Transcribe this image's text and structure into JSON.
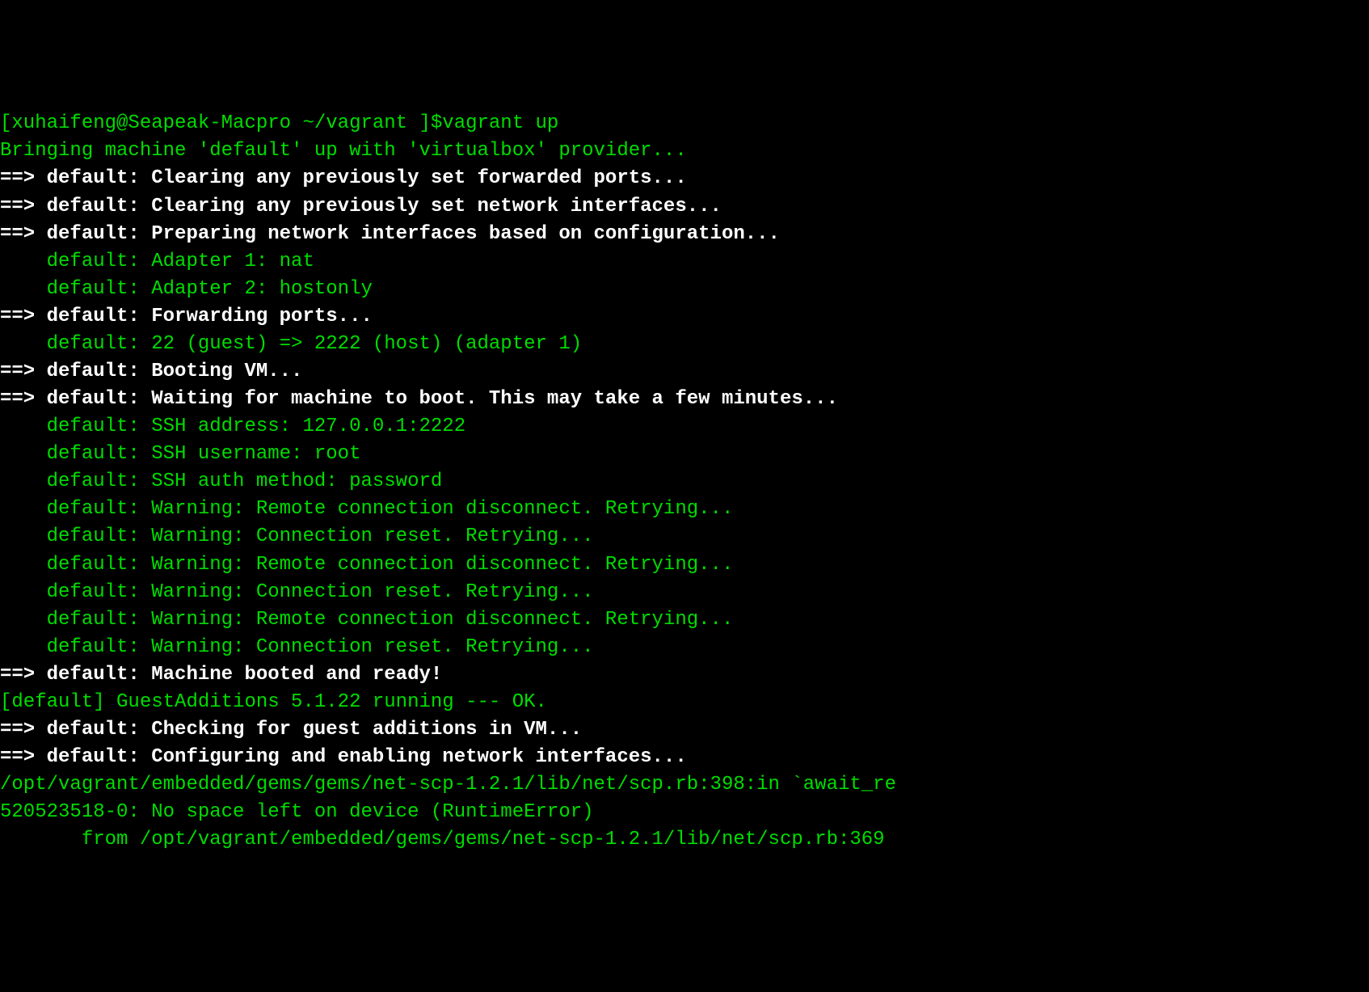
{
  "lines": [
    {
      "style": "green",
      "indent": 0,
      "text": "[xuhaifeng@Seapeak-Macpro ~/vagrant ]$vagrant up"
    },
    {
      "style": "green",
      "indent": 0,
      "text": "Bringing machine 'default' up with 'virtualbox' provider..."
    },
    {
      "style": "bright",
      "indent": 0,
      "text": "==> default: Clearing any previously set forwarded ports..."
    },
    {
      "style": "bright",
      "indent": 0,
      "text": "==> default: Clearing any previously set network interfaces..."
    },
    {
      "style": "bright",
      "indent": 0,
      "text": "==> default: Preparing network interfaces based on configuration..."
    },
    {
      "style": "green",
      "indent": 1,
      "text": "default: Adapter 1: nat"
    },
    {
      "style": "green",
      "indent": 1,
      "text": "default: Adapter 2: hostonly"
    },
    {
      "style": "bright",
      "indent": 0,
      "text": "==> default: Forwarding ports..."
    },
    {
      "style": "green",
      "indent": 1,
      "text": "default: 22 (guest) => 2222 (host) (adapter 1)"
    },
    {
      "style": "bright",
      "indent": 0,
      "text": "==> default: Booting VM..."
    },
    {
      "style": "bright",
      "indent": 0,
      "text": "==> default: Waiting for machine to boot. This may take a few minutes..."
    },
    {
      "style": "green",
      "indent": 1,
      "text": "default: SSH address: 127.0.0.1:2222"
    },
    {
      "style": "green",
      "indent": 1,
      "text": "default: SSH username: root"
    },
    {
      "style": "green",
      "indent": 1,
      "text": "default: SSH auth method: password"
    },
    {
      "style": "green",
      "indent": 1,
      "text": "default: Warning: Remote connection disconnect. Retrying..."
    },
    {
      "style": "green",
      "indent": 1,
      "text": "default: Warning: Connection reset. Retrying..."
    },
    {
      "style": "green",
      "indent": 1,
      "text": "default: Warning: Remote connection disconnect. Retrying..."
    },
    {
      "style": "green",
      "indent": 1,
      "text": "default: Warning: Connection reset. Retrying..."
    },
    {
      "style": "green",
      "indent": 1,
      "text": "default: Warning: Remote connection disconnect. Retrying..."
    },
    {
      "style": "green",
      "indent": 1,
      "text": "default: Warning: Connection reset. Retrying..."
    },
    {
      "style": "bright",
      "indent": 0,
      "text": "==> default: Machine booted and ready!"
    },
    {
      "style": "green",
      "indent": 0,
      "text": "[default] GuestAdditions 5.1.22 running --- OK."
    },
    {
      "style": "bright",
      "indent": 0,
      "text": "==> default: Checking for guest additions in VM..."
    },
    {
      "style": "bright",
      "indent": 0,
      "text": "==> default: Configuring and enabling network interfaces..."
    },
    {
      "style": "green",
      "indent": 0,
      "text": "/opt/vagrant/embedded/gems/gems/net-scp-1.2.1/lib/net/scp.rb:398:in `await_re"
    },
    {
      "style": "green",
      "indent": 0,
      "text": "520523518-0: No space left on device (RuntimeError)"
    },
    {
      "style": "green",
      "indent": 2,
      "text": "from /opt/vagrant/embedded/gems/gems/net-scp-1.2.1/lib/net/scp.rb:369"
    }
  ],
  "indent_unit": "    ",
  "indent_trace": "       "
}
